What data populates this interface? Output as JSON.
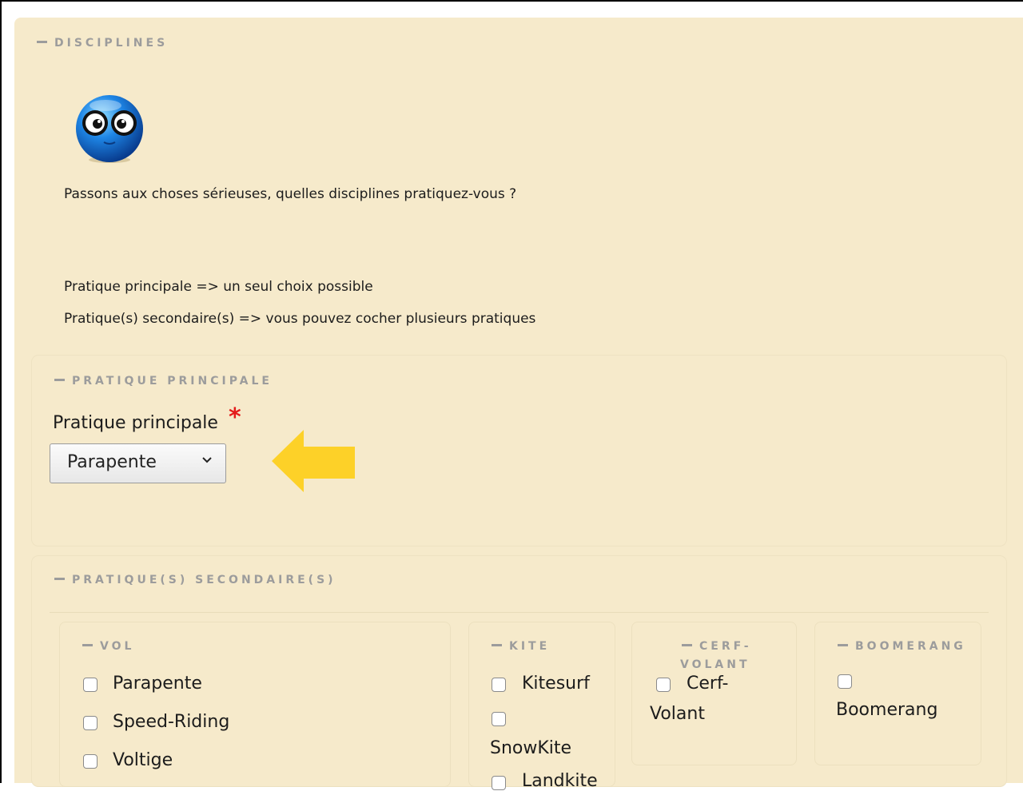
{
  "disciplines": {
    "legend": "DISCIPLINES",
    "question": "Passons aux choses sérieuses, quelles disciplines pratiquez-vous ?",
    "rule_main": "Pratique principale => un seul choix possible",
    "rule_secondary": "Pratique(s) secondaire(s) => vous pouvez cocher plusieurs pratiques"
  },
  "principale": {
    "legend": "PRATIQUE PRINCIPALE",
    "label": "Pratique principale",
    "required_mark": "*",
    "selected": "Parapente"
  },
  "secondaire": {
    "legend": "PRATIQUE(S) SECONDAIRE(S)",
    "vol": {
      "legend": "VOL",
      "options": [
        "Parapente",
        "Speed-Riding",
        "Voltige"
      ]
    },
    "kite": {
      "legend": "KITE",
      "options": [
        "Kitesurf",
        "SnowKite",
        "Landkite"
      ]
    },
    "cerf": {
      "legend_1": "CERF-",
      "legend_2": "VOLANT",
      "option_1": "Cerf-",
      "option_2": "Volant"
    },
    "boomerang": {
      "legend": "BOOMERANG",
      "option": "Boomerang"
    }
  },
  "colors": {
    "background": "#f6eacb",
    "legend": "#9c9c9c",
    "required": "#e41b1b",
    "arrow": "#fdd128"
  }
}
